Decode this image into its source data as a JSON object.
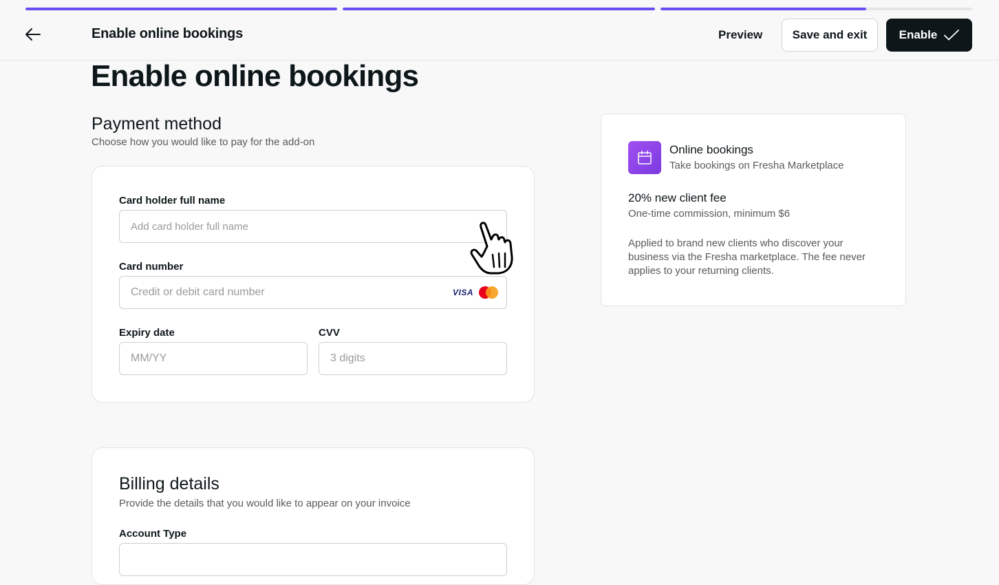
{
  "progress": {
    "segments": [
      1.0,
      1.0,
      0.66
    ]
  },
  "topbar": {
    "title": "Enable online bookings",
    "preview_label": "Preview",
    "save_label": "Save and exit",
    "enable_label": "Enable"
  },
  "page": {
    "title": "Enable online bookings"
  },
  "payment": {
    "title": "Payment method",
    "subtitle": "Choose how you would like to pay for the add-on",
    "cardholder_label": "Card holder full name",
    "cardholder_placeholder": "Add card holder full name",
    "card_number_label": "Card number",
    "card_number_placeholder": "Credit or debit card number",
    "visa_text": "VISA",
    "expiry_label": "Expiry date",
    "expiry_placeholder": "MM/YY",
    "cvv_label": "CVV",
    "cvv_placeholder": "3 digits"
  },
  "billing": {
    "title": "Billing details",
    "subtitle": "Provide the details that you would like to appear on your invoice",
    "account_type_label": "Account Type"
  },
  "addon": {
    "icon": "calendar-icon",
    "name": "Online bookings",
    "description": "Take bookings on Fresha Marketplace",
    "fee_title": "20% new client fee",
    "fee_subtitle": "One-time commission, minimum $6",
    "fee_note": "Applied to brand new clients who discover your business via the Fresha marketplace. The fee never applies to your returning clients."
  },
  "colors": {
    "accent": "#6950f3",
    "primary_button": "#0d1619",
    "app_icon": "#8e44ec"
  }
}
